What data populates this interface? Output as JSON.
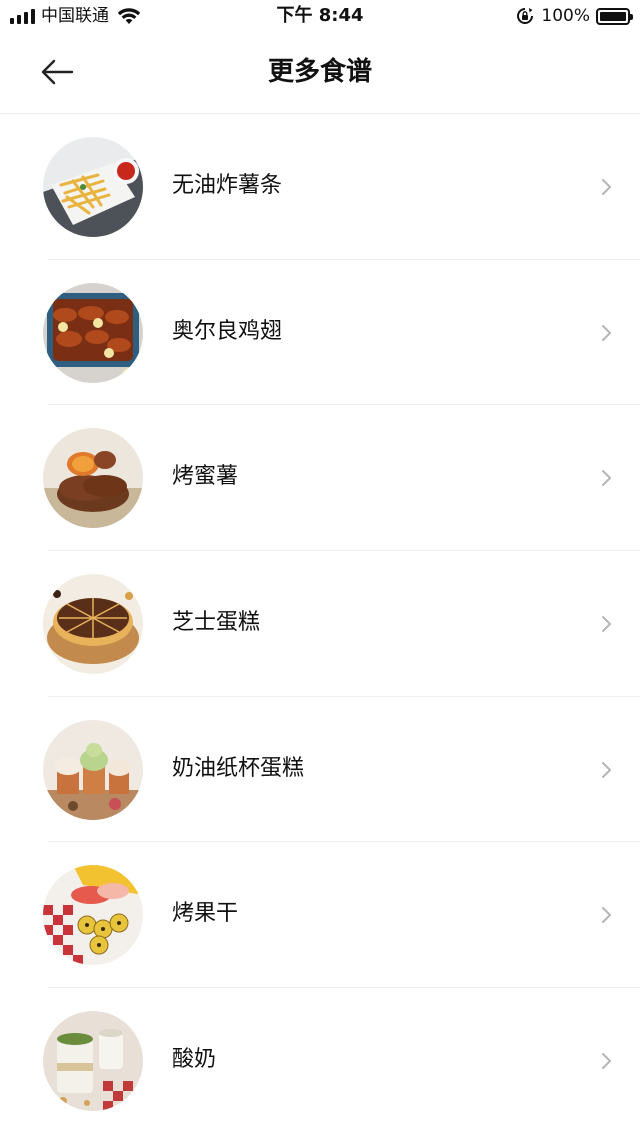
{
  "status_bar": {
    "carrier": "中国联通",
    "time": "下午 8:44",
    "battery": "100%"
  },
  "nav": {
    "title": "更多食谱",
    "back_icon": "arrow-left-icon"
  },
  "recipes": [
    {
      "name": "无油炸薯条"
    },
    {
      "name": "奥尔良鸡翅"
    },
    {
      "name": "烤蜜薯"
    },
    {
      "name": "芝士蛋糕"
    },
    {
      "name": "奶油纸杯蛋糕"
    },
    {
      "name": "烤果干"
    },
    {
      "name": "酸奶"
    }
  ],
  "colors": {
    "text": "#111111",
    "separator": "#eeeeee",
    "chevron": "#b5b5b5"
  }
}
